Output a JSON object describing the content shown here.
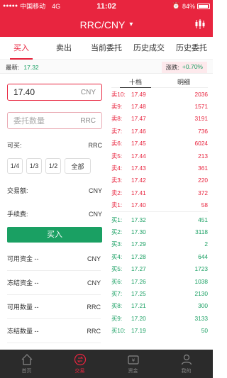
{
  "status_bar": {
    "carrier": "中国移动",
    "network": "4G",
    "time": "11:02",
    "battery": "84%"
  },
  "header": {
    "title": "RRC/CNY",
    "caret_icon": "chevron-down-icon",
    "menu_icon": "candlestick-icon"
  },
  "tabs": [
    "买入",
    "卖出",
    "当前委托",
    "历史成交",
    "历史委托"
  ],
  "ticker": {
    "latest_label": "最新:",
    "latest_value": "17.32",
    "change_label": "涨跌:",
    "change_value": "+0.70%"
  },
  "form": {
    "price_value": "17.40",
    "price_unit": "CNY",
    "amount_placeholder": "委托数量",
    "amount_unit": "RRC",
    "available_label": "可买:",
    "available_unit": "RRC",
    "pct_buttons": [
      "1/4",
      "1/3",
      "1/2",
      "全部"
    ],
    "turnover_label": "交易额:",
    "turnover_unit": "CNY",
    "fee_label": "手续费:",
    "fee_unit": "CNY",
    "buy_button": "买入"
  },
  "balances": [
    {
      "label": "可用资金 --",
      "unit": "CNY"
    },
    {
      "label": "冻结资金 --",
      "unit": "CNY"
    },
    {
      "label": "可用数量 --",
      "unit": "RRC"
    },
    {
      "label": "冻结数量 --",
      "unit": "RRC"
    }
  ],
  "book": {
    "tabs": [
      "十档",
      "明细"
    ],
    "asks": [
      {
        "side": "卖10:",
        "price": "17.49",
        "qty": "2036"
      },
      {
        "side": "卖9:",
        "price": "17.48",
        "qty": "1571"
      },
      {
        "side": "卖8:",
        "price": "17.47",
        "qty": "3191"
      },
      {
        "side": "卖7:",
        "price": "17.46",
        "qty": "736"
      },
      {
        "side": "卖6:",
        "price": "17.45",
        "qty": "6024"
      },
      {
        "side": "卖5:",
        "price": "17.44",
        "qty": "213"
      },
      {
        "side": "卖4:",
        "price": "17.43",
        "qty": "361"
      },
      {
        "side": "卖3:",
        "price": "17.42",
        "qty": "220"
      },
      {
        "side": "卖2:",
        "price": "17.41",
        "qty": "372"
      },
      {
        "side": "卖1:",
        "price": "17.40",
        "qty": "58"
      }
    ],
    "bids": [
      {
        "side": "买1:",
        "price": "17.32",
        "qty": "451"
      },
      {
        "side": "买2:",
        "price": "17.30",
        "qty": "3118"
      },
      {
        "side": "买3:",
        "price": "17.29",
        "qty": "2"
      },
      {
        "side": "买4:",
        "price": "17.28",
        "qty": "644"
      },
      {
        "side": "买5:",
        "price": "17.27",
        "qty": "1723"
      },
      {
        "side": "买6:",
        "price": "17.26",
        "qty": "1038"
      },
      {
        "side": "买7:",
        "price": "17.25",
        "qty": "2130"
      },
      {
        "side": "买8:",
        "price": "17.21",
        "qty": "300"
      },
      {
        "side": "买9:",
        "price": "17.20",
        "qty": "3133"
      },
      {
        "side": "买10:",
        "price": "17.19",
        "qty": "50"
      }
    ]
  },
  "bottom_nav": [
    {
      "label": "首页",
      "icon": "home-icon"
    },
    {
      "label": "交易",
      "icon": "trade-icon"
    },
    {
      "label": "资金",
      "icon": "wallet-icon"
    },
    {
      "label": "我的",
      "icon": "user-icon"
    }
  ],
  "colors": {
    "brand_red": "#e8253f",
    "up_green": "#1aa063",
    "nav_bg": "#2b2b2b"
  }
}
